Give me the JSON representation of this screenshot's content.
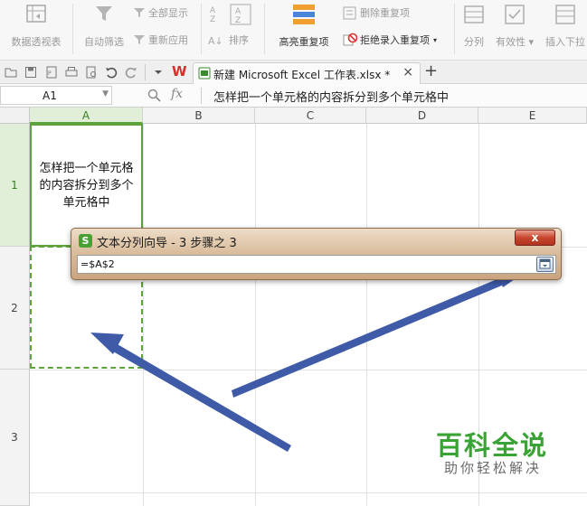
{
  "ribbon": {
    "pivot_table": "数据透视表",
    "auto_filter": "自动筛选",
    "show_all": "全部显示",
    "reapply": "重新应用",
    "sort": "排序",
    "highlight_duplicates": "高亮重复项",
    "delete_duplicates": "删除重复项",
    "reject_duplicates": "拒绝录入重复项",
    "split": "分列",
    "validity": "有效性",
    "insert_dropdown": "插入下拉"
  },
  "tabs": {
    "app_logo": "W",
    "document_title": "新建 Microsoft Excel 工作表.xlsx *",
    "close": "×",
    "add": "+"
  },
  "formula_bar": {
    "name_box": "A1",
    "fx": "fx",
    "formula": "怎样把一个单元格的内容拆分到多个单元格中"
  },
  "grid": {
    "columns": [
      "A",
      "B",
      "C",
      "D",
      "E"
    ],
    "rows": [
      "1",
      "2",
      "3"
    ],
    "cell_a1": "怎样把一个单元格的内容拆分到多个单元格中"
  },
  "dialog": {
    "logo": "S",
    "title": "文本分列向导 - 3 步骤之 3",
    "close": "x",
    "input_value": "=$A$2"
  },
  "watermark": {
    "title": "百科全说",
    "subtitle": "助你轻松解决"
  },
  "colors": {
    "selection_green": "#5ea33a",
    "arrow_blue": "#3f5ba8",
    "watermark_green": "#3aa335"
  }
}
